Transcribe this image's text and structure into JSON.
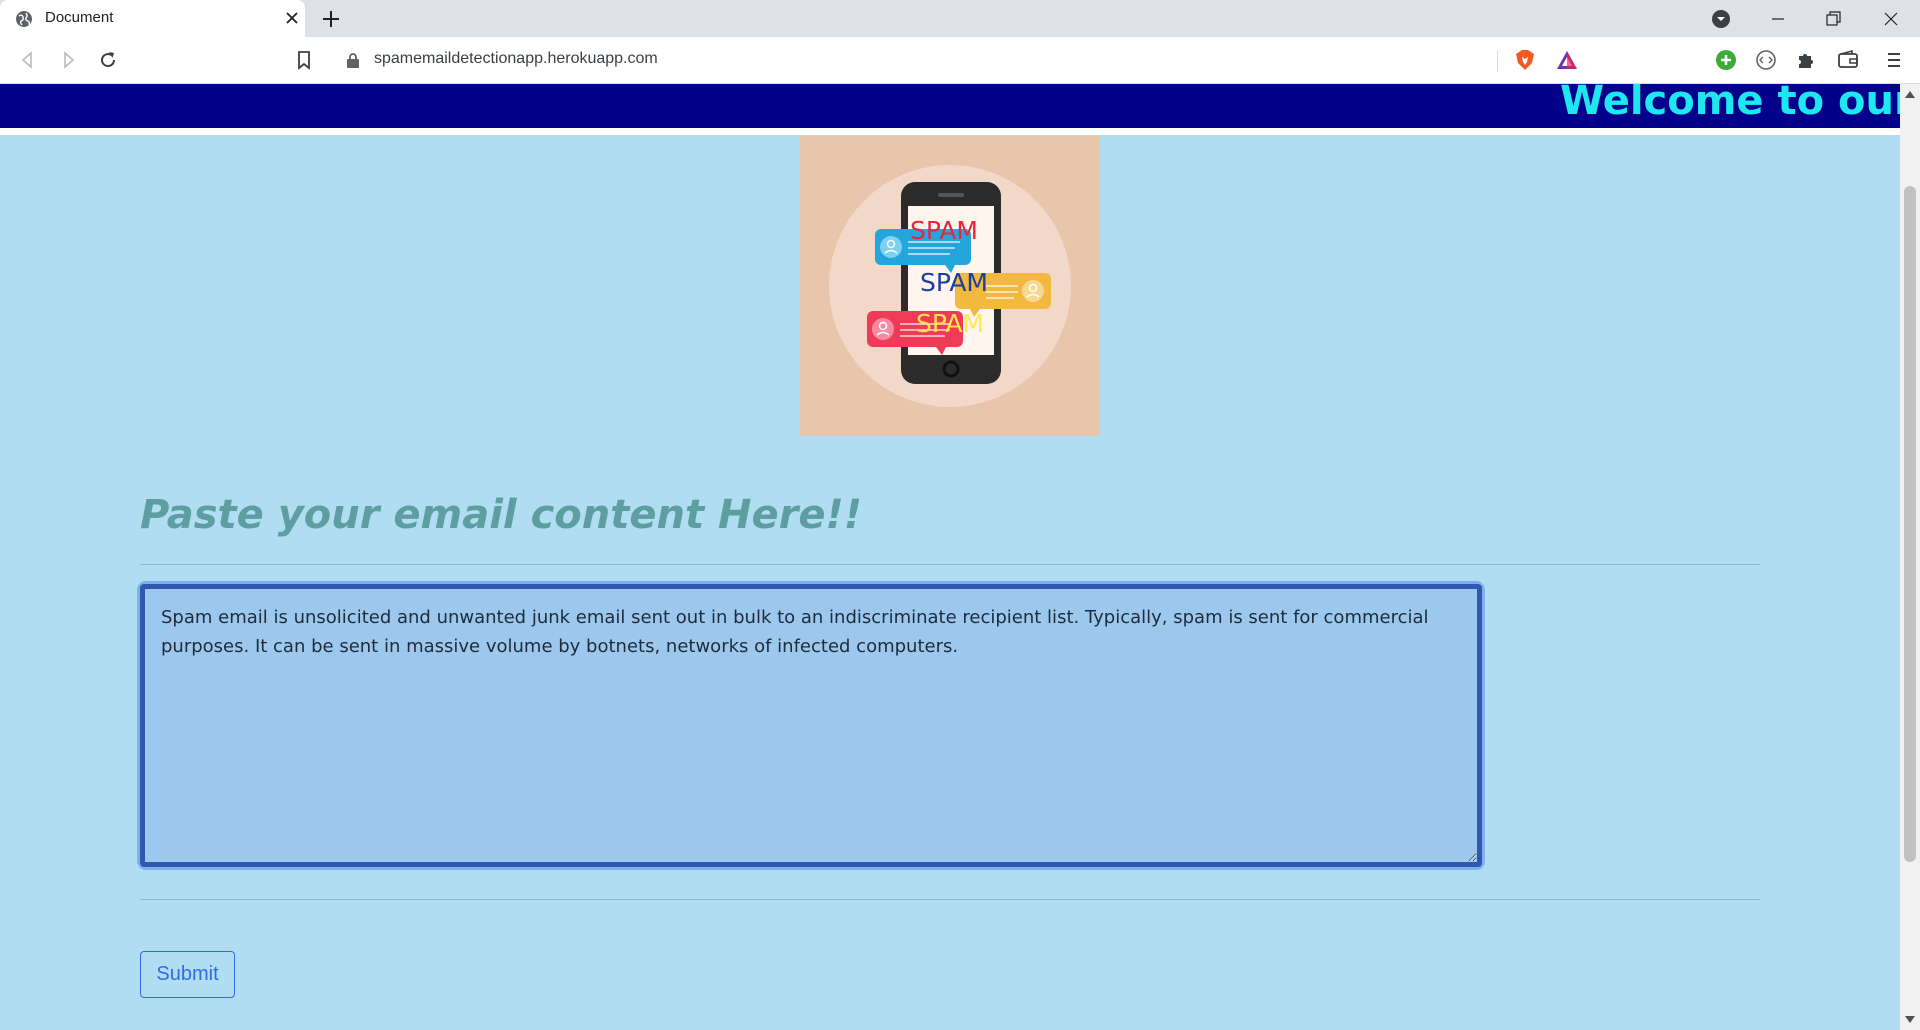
{
  "browser": {
    "tab_title": "Document",
    "url": "spamemaildetectionapp.herokuapp.com"
  },
  "page": {
    "banner_text": "Welcome to our W",
    "hero_image": {
      "labels": [
        "SPAM",
        "SPAM",
        "SPAM"
      ]
    },
    "heading": "Paste your email content Here!!",
    "email_text": "Spam email is unsolicited and unwanted junk email sent out in bulk to an indiscriminate recipient list. Typically, spam is sent for commercial purposes. It can be sent in massive volume by botnets, networks of infected computers.",
    "submit_label": "Submit"
  },
  "colors": {
    "page_bg": "#b0ddf2",
    "banner_bg": "#00008b",
    "banner_text": "#1ee7f0",
    "heading": "#5d9ea0",
    "textarea_border": "#2f58b0",
    "textarea_bg": "#9dc8ee",
    "button": "#2f6ce5"
  }
}
